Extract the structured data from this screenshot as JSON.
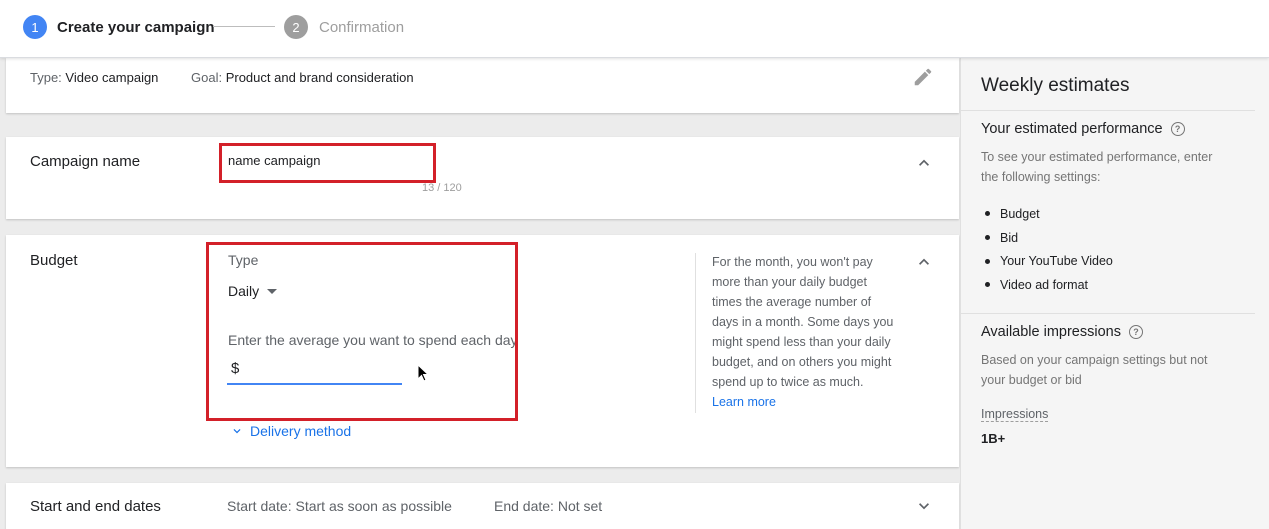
{
  "stepper": {
    "step1_number": "1",
    "step1_label": "Create your campaign",
    "step2_number": "2",
    "step2_label": "Confirmation"
  },
  "summary": {
    "type_label": "Type:",
    "type_value": "Video campaign",
    "goal_label": "Goal:",
    "goal_value": "Product and brand consideration"
  },
  "campaign_name": {
    "title": "Campaign name",
    "value": "name campaign",
    "char_count": "13 / 120"
  },
  "budget": {
    "title": "Budget",
    "type_label": "Type",
    "type_value": "Daily",
    "prompt": "Enter the average you want to spend each day",
    "currency": "$",
    "delivery_link": "Delivery method",
    "help_text": "For the month, you won't pay more than your daily budget times the average number of days in a month. Some days you might spend less than your daily budget, and on others you might spend up to twice as much.",
    "learn_more": "Learn more"
  },
  "dates": {
    "title": "Start and end dates",
    "start": "Start date: Start as soon as possible",
    "end": "End date: Not set"
  },
  "panel": {
    "title": "Weekly estimates",
    "perf_title": "Your estimated performance",
    "perf_text_1": "To see your estimated performance, enter",
    "perf_text_2": "the following settings:",
    "settings": [
      "Budget",
      "Bid",
      "Your YouTube Video",
      "Video ad format"
    ],
    "impr_title": "Available impressions",
    "impr_text_1": "Based on your campaign settings but not",
    "impr_text_2": "your budget or bid",
    "impr_label": "Impressions",
    "impr_value": "1B+"
  },
  "colors": {
    "accent": "#4285f4",
    "link": "#1a73e8",
    "highlight_box": "#d32029"
  }
}
